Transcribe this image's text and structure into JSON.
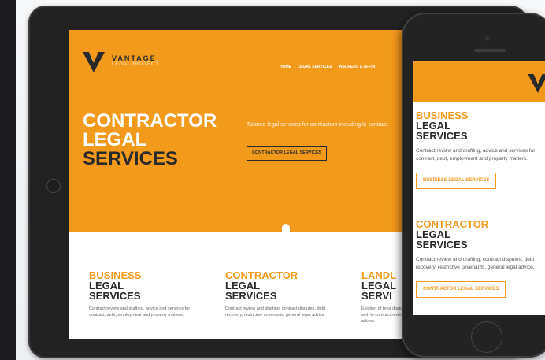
{
  "colors": {
    "accent": "#f39a1c",
    "dark": "#2a2a2a",
    "bezel": "#222222"
  },
  "brand": {
    "name": "VANTAGE",
    "tagline": "LEGALPROTECT"
  },
  "nav": {
    "items": [
      "HOME",
      "LEGAL SERVICES",
      "INSURERS & AFFIN"
    ]
  },
  "hero": {
    "title_line1": "CONTRACTOR",
    "title_line2": "LEGAL",
    "title_line3": "SERVICES",
    "copy": "Tailored legal services for contractors including le contract.",
    "button_label": "CONTRACTOR LEGAL SERVICES"
  },
  "services": [
    {
      "title_a": "BUSINESS",
      "title_b": "LEGAL",
      "title_c": "SERVICES",
      "desc": "Contract review and drafting, advice and services for contract, debt, employment and property matters."
    },
    {
      "title_a": "CONTRACTOR",
      "title_b": "LEGAL",
      "title_c": "SERVICES",
      "desc": "Contract review and drafting, contract disputes, debt recovery, restrictive covenants, general legal advice."
    },
    {
      "title_a": "LANDL",
      "title_b": "LEGAL",
      "title_c": "SERVI",
      "desc": "Eviction of tena disputes with te contract review advice."
    }
  ],
  "phone": {
    "sections": [
      {
        "title_a": "BUSINESS",
        "title_b": "LEGAL",
        "title_c": "SERVICES",
        "desc": "Contract review and drafting, advice and services for contract, debt, employment and property matters.",
        "button_label": "BUSINESS LEGAL SERVICES"
      },
      {
        "title_a": "CONTRACTOR",
        "title_b": "LEGAL",
        "title_c": "SERVICES",
        "desc": "Contract review and drafting, contract disputes, debt recovery, restrictive covenants, general legal advice.",
        "button_label": "CONTRACTOR LEGAL SERVICES"
      }
    ]
  },
  "icons": {
    "logo": "v-chevron-logo"
  }
}
